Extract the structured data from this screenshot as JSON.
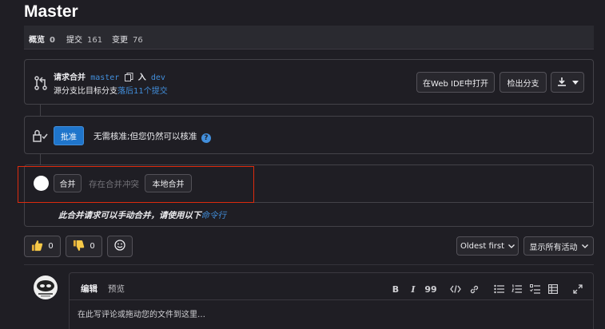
{
  "page": {
    "title": "Master"
  },
  "tabs": [
    {
      "label": "概览",
      "count": "0"
    },
    {
      "label": "提交",
      "count": "161"
    },
    {
      "label": "变更",
      "count": "76"
    }
  ],
  "mr_widget": {
    "request_label": "请求合并",
    "source_branch": "master",
    "into_label": "入",
    "target_branch": "dev",
    "behind_prefix": "源分支比目标分支",
    "behind_link": "落后11个提交",
    "web_ide_button": "在Web IDE中打开",
    "checkout_button": "检出分支"
  },
  "approval": {
    "approve_button": "批准",
    "text": "无需核准;但您仍然可以核准"
  },
  "merge": {
    "merge_button": "合并",
    "conflict_text": "存在合并冲突",
    "local_merge_button": "本地合并",
    "manual_text": "此合并请求可以手动合并，请使用以下",
    "manual_link": "命令行"
  },
  "reactions": {
    "thumbs_up_count": "0",
    "thumbs_down_count": "0"
  },
  "activity": {
    "sort_label": "Oldest first",
    "filter_label": "显示所有活动"
  },
  "comment": {
    "tab_edit": "编辑",
    "tab_preview": "预览",
    "placeholder": "在此写评论或拖动您的文件到这里…",
    "toolbar": {
      "bold": "B",
      "italic": "I",
      "quote": "99"
    }
  },
  "colors": {
    "background": "#1f1e24",
    "accent_blue": "#1f75cb",
    "link_blue": "#428fdc",
    "highlight_red": "#dd2b0e"
  }
}
